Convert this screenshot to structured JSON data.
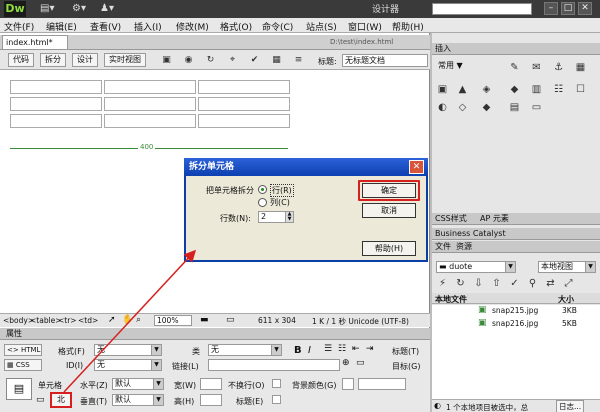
{
  "app": {
    "logo": "Dw",
    "designer": "设计器",
    "toolbar_icons": [
      "layout-icon",
      "settings-icon",
      "user-icon"
    ]
  },
  "menu": [
    "文件(F)",
    "编辑(E)",
    "查看(V)",
    "插入(I)",
    "修改(M)",
    "格式(O)",
    "命令(C)",
    "站点(S)",
    "窗口(W)",
    "帮助(H)"
  ],
  "document": {
    "tab": "index.html*",
    "path": "D:\\test\\index.html",
    "views": [
      "代码",
      "拆分",
      "设计",
      "实时视图"
    ],
    "title_label": "标题:",
    "title_value": "无标题文档",
    "table_width_label": "400"
  },
  "status": {
    "tags": [
      "<body>",
      "<table>",
      "<tr>",
      "<td>"
    ],
    "zoom": "100%",
    "size": "611 x 304",
    "info": "1 K / 1 秒  Unicode (UTF-8)"
  },
  "properties": {
    "header": "属性",
    "html_btn": "HTML",
    "css_btn": "CSS",
    "format_label": "格式(F)",
    "format_value": "无",
    "id_label": "ID(I)",
    "id_value": "无",
    "class_label": "类",
    "class_value": "无",
    "link_label": "链接(L)",
    "bold": "B",
    "italic": "I",
    "title_label": "标题(T)",
    "target_label": "目标(G)",
    "cell_label": "单元格",
    "split_btn": "北",
    "horz_label": "水平(Z)",
    "horz_value": "默认",
    "vert_label": "垂直(T)",
    "vert_value": "默认",
    "width_label": "宽(W)",
    "height_label": "高(H)",
    "nowrap_label": "不换行(O)",
    "header_label": "标题(E)",
    "bg_label": "背景颜色(G)"
  },
  "insert_panel": {
    "header": "插入",
    "category": "常用"
  },
  "css_panel": {
    "tabs": [
      "CSS样式",
      "AP 元素"
    ]
  },
  "bc_panel": {
    "header": "Business Catalyst"
  },
  "files_panel": {
    "tabs": [
      "文件",
      "资源"
    ],
    "site": "duote",
    "view": "本地视图",
    "col_name": "本地文件",
    "col_size": "大小",
    "files": [
      {
        "name": "snap215.jpg",
        "size": "3KB"
      },
      {
        "name": "snap216.jpg",
        "size": "5KB"
      }
    ],
    "status": "1 个本地项目被选中，总",
    "log": "日志..."
  },
  "dialog": {
    "title": "拆分单元格",
    "split_label": "把单元格拆分",
    "opt_rows": "行(R)",
    "opt_cols": "列(C)",
    "count_label": "行数(N):",
    "count_value": "2",
    "ok": "确定",
    "cancel": "取消",
    "help": "帮助(H)"
  },
  "colors": {
    "dialog_title": "#2d62d9",
    "highlight": "#d62020",
    "table_guide": "#3a8a3a"
  }
}
